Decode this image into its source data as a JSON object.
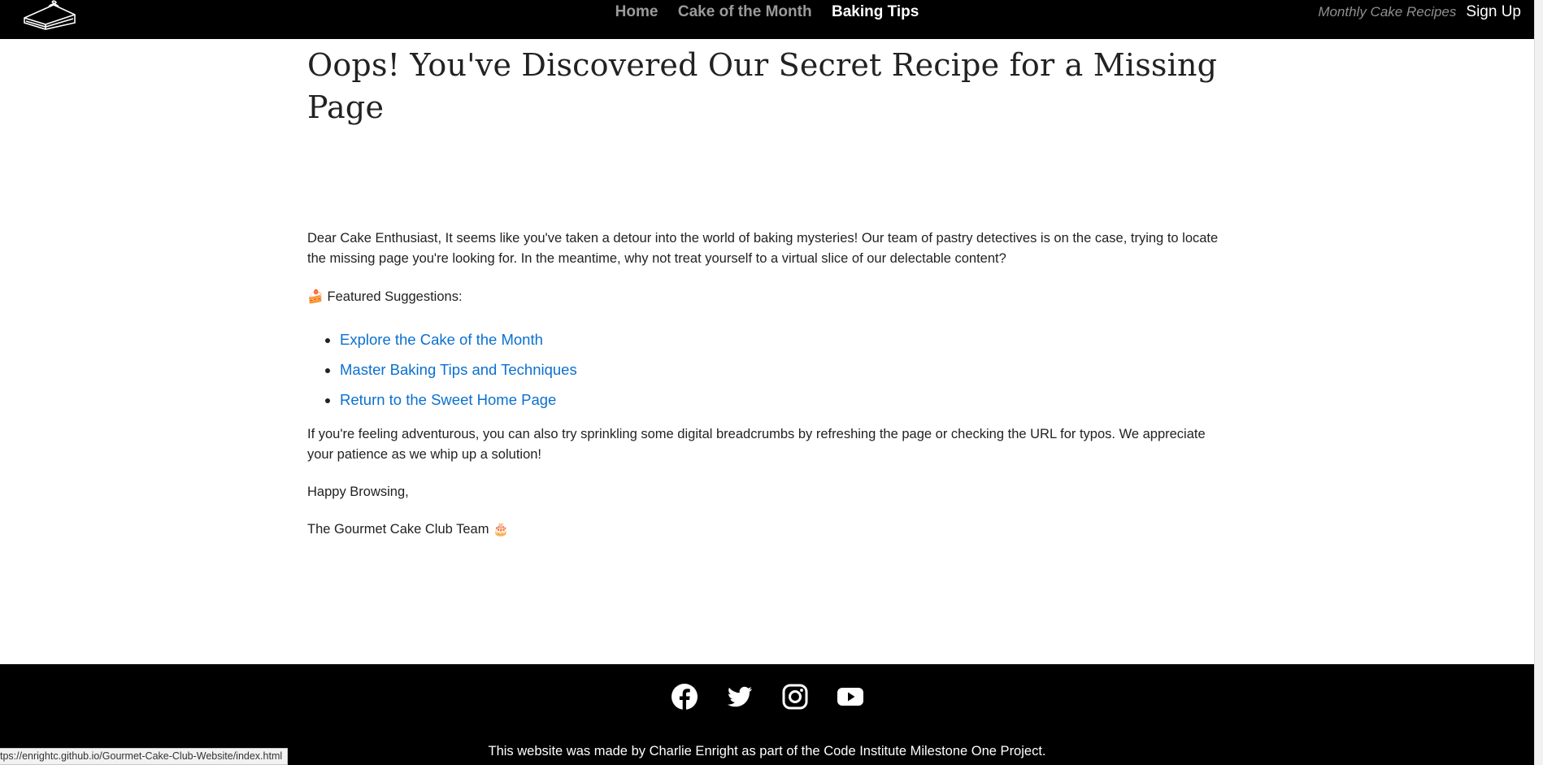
{
  "nav": {
    "links": [
      {
        "label": "Home",
        "active": false
      },
      {
        "label": "Cake of the Month",
        "active": false
      },
      {
        "label": "Baking Tips",
        "active": true
      }
    ],
    "tagline": "Monthly Cake Recipes",
    "signup_label": "Sign Up",
    "logo_icon": "cake-slice-icon"
  },
  "main": {
    "title": "Oops! You've Discovered Our Secret Recipe for a Missing Page",
    "intro": "Dear Cake Enthusiast, It seems like you've taken a detour into the world of baking mysteries! Our team of pastry detectives is on the case, trying to locate the missing page you're looking for. In the meantime, why not treat yourself to a virtual slice of our delectable content?",
    "featured_emoji": "🍰",
    "featured_label": "Featured Suggestions:",
    "suggestions": [
      "Explore the Cake of the Month",
      "Master Baking Tips and Techniques",
      "Return to the Sweet Home Page"
    ],
    "outro": "If you're feeling adventurous, you can also try sprinkling some digital breadcrumbs by refreshing the page or checking the URL for typos. We appreciate your patience as we whip up a solution!",
    "sign_off": "Happy Browsing,",
    "team": "The Gourmet Cake Club Team",
    "team_emoji": "🎂"
  },
  "footer": {
    "social_icons": [
      "facebook-icon",
      "twitter-icon",
      "instagram-icon",
      "youtube-icon"
    ],
    "credit": "This website was made by Charlie Enright as part of the Code Institute Milestone One Project."
  },
  "status_bar": {
    "url": "tps://enrightc.github.io/Gourmet-Cake-Club-Website/index.html"
  },
  "colors": {
    "nav_bg": "#000000",
    "nav_inactive": "#9a9a9a",
    "nav_active": "#ffffff",
    "link": "#0a70d0",
    "footer_bg": "#000000"
  }
}
